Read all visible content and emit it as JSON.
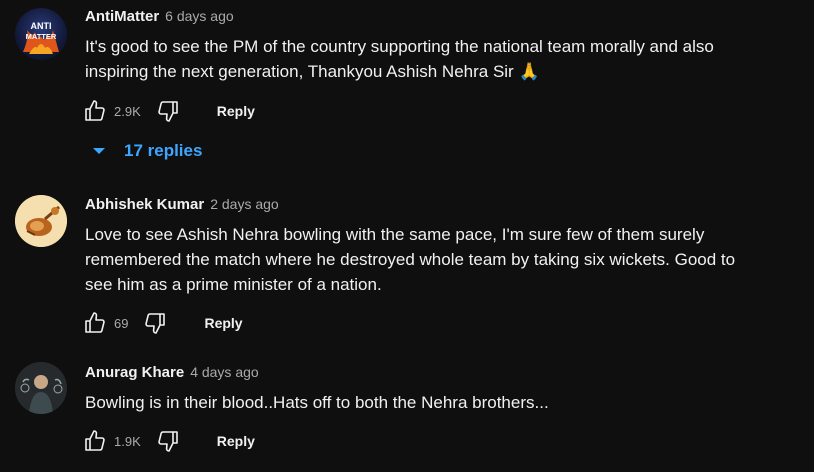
{
  "comments": [
    {
      "author": "AntiMatter",
      "time": "6 days ago",
      "text": "It's good to see the PM of the country supporting the national team morally and also inspiring the next generation, Thankyou Ashish Nehra Sir 🙏",
      "likes": "2.9K",
      "reply_label": "Reply",
      "avatar_text_top": "ANTI",
      "avatar_text_bottom": "MATTER",
      "replies_label": "17 replies"
    },
    {
      "author": "Abhishek Kumar",
      "time": "2 days ago",
      "text": "Love to see Ashish Nehra bowling with the same pace, I'm sure few of them surely remembered the match where he destroyed whole team by taking six wickets. Good to see him as a prime minister of a nation.",
      "likes": "69",
      "reply_label": "Reply"
    },
    {
      "author": "Anurag Khare",
      "time": "4 days ago",
      "text": "Bowling is in their blood..Hats off to both the Nehra brothers...",
      "likes": "1.9K",
      "reply_label": "Reply"
    }
  ],
  "colors": {
    "background": "#0f0f0f",
    "text": "#f1f1f1",
    "muted": "#aaaaaa",
    "link": "#3ea6ff"
  }
}
